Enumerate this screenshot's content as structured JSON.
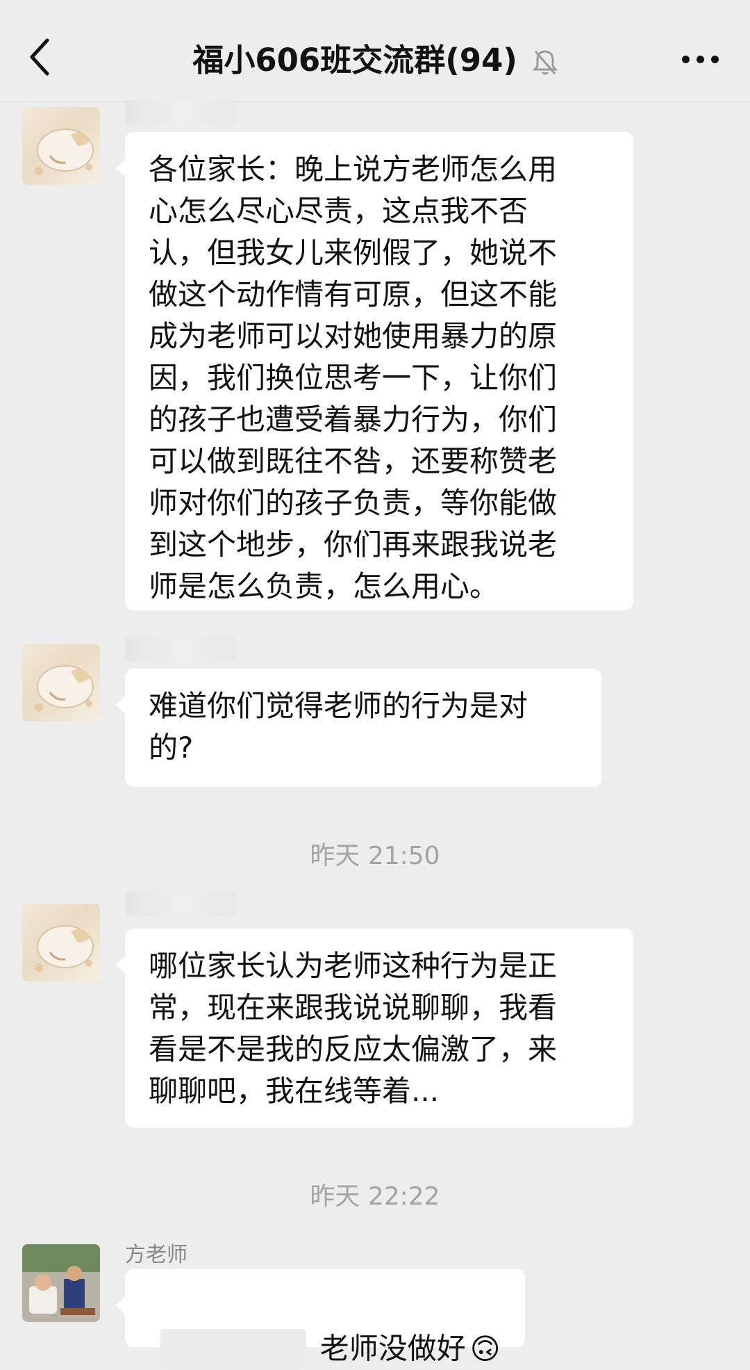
{
  "header": {
    "back_icon": "chevron-left-icon",
    "title": "福小606班交流群(94)",
    "mute_icon": "bell-off-icon",
    "more_icon": "ellipsis-icon"
  },
  "messages": [
    {
      "text": "各位家长：晚上说方老师怎么用\n心怎么尽心尽责，这点我不否\n认，但我女儿来例假了，她说不\n做这个动作情有可原，但这不能\n成为老师可以对她使用暴力的原\n因，我们换位思考一下，让你们\n的孩子也遭受着暴力行为，你们\n可以做到既往不咎，还要称赞老\n师对你们的孩子负责，等你能做\n到这个地步，你们再来跟我说老\n师是怎么负责，怎么用心。"
    },
    {
      "text": "难道你们觉得老师的行为是对\n的?"
    },
    {
      "timestamp": "昨天 21:50"
    },
    {
      "text": "哪位家长认为老师这种行为是正\n常，现在来跟我说说聊聊，我看\n看是不是我的反应太偏激了，来\n聊聊吧，我在线等着..."
    },
    {
      "timestamp": "昨天 22:22"
    },
    {
      "sender": "方老师",
      "text": "老师没做好",
      "emoji": "🙃"
    }
  ]
}
